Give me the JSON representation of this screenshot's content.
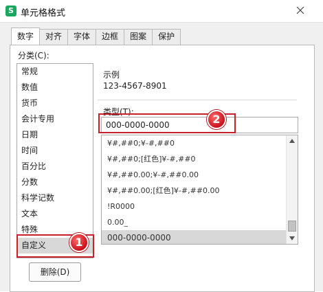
{
  "window": {
    "title": "单元格格式",
    "app_icon": "S",
    "app_icon_color": "#1aa860"
  },
  "tabs": [
    {
      "label": "数字",
      "active": true
    },
    {
      "label": "对齐",
      "active": false
    },
    {
      "label": "字体",
      "active": false
    },
    {
      "label": "边框",
      "active": false
    },
    {
      "label": "图案",
      "active": false
    },
    {
      "label": "保护",
      "active": false
    }
  ],
  "category": {
    "label": "分类(C):",
    "items": [
      "常规",
      "数值",
      "货币",
      "会计专用",
      "日期",
      "时间",
      "百分比",
      "分数",
      "科学记数",
      "文本",
      "特殊",
      "自定义"
    ],
    "selected": "自定义"
  },
  "sample": {
    "label": "示例",
    "value": "123-4567-8901"
  },
  "type": {
    "label": "类型(T):",
    "value": "000-0000-0000"
  },
  "formats": {
    "items": [
      "¥#,##0;¥-#,##0",
      "¥#,##0;[红色]¥-#,##0",
      "¥#,##0.00;¥-#,##0.00",
      "¥#,##0.00;[红色]¥-#,##0.00",
      "!R0000",
      "0.00_",
      "000-0000-0000"
    ],
    "selected": "000-0000-0000"
  },
  "buttons": {
    "delete_label": "删除(D)"
  },
  "annotations": {
    "badge_1": "1",
    "badge_2": "2",
    "color": "#c8202a"
  }
}
